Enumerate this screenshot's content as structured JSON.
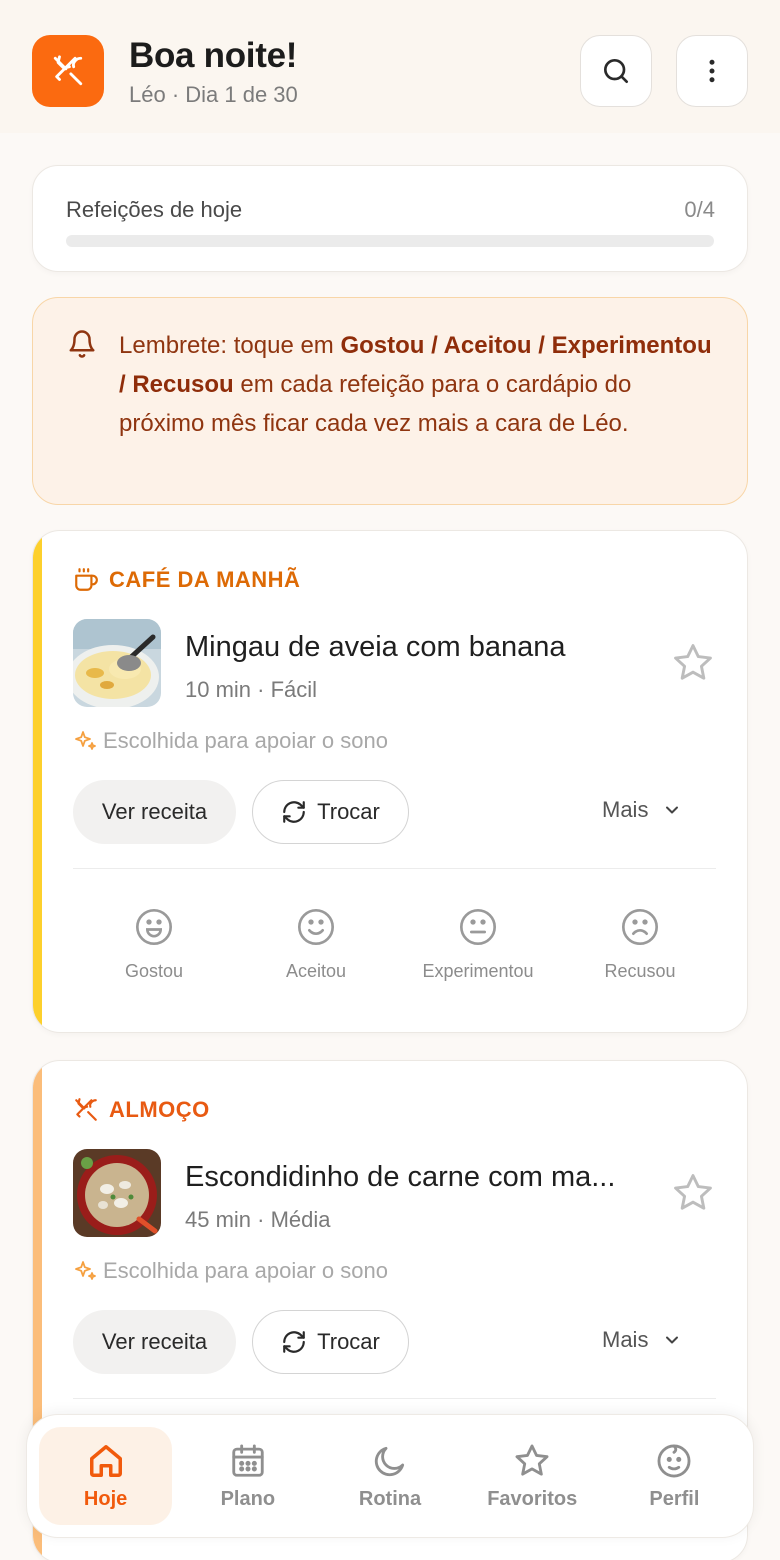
{
  "header": {
    "greeting": "Boa noite!",
    "subtitle": "Léo · Dia 1 de 30"
  },
  "progress": {
    "label": "Refeições de hoje",
    "count": "0/4",
    "completed": 0,
    "total": 4
  },
  "reminder": {
    "prefix": "Lembrete: toque em ",
    "bold": "Gostou / Aceitou / Experimentou / Recusou",
    "suffix": " em cada refeição para o cardápio do próximo mês ficar cada vez mais a cara de Léo."
  },
  "meals": [
    {
      "type": "CAFÉ DA MANHÃ",
      "title": "Mingau de aveia com banana",
      "meta": "10 min · Fácil",
      "reason": "Escolhida para apoiar o sono",
      "view_label": "Ver receita",
      "swap_label": "Trocar",
      "more_label": "Mais"
    },
    {
      "type": "ALMOÇO",
      "title": "Escondidinho de carne com ma...",
      "meta": "45 min · Média",
      "reason": "Escolhida para apoiar o sono",
      "view_label": "Ver receita",
      "swap_label": "Trocar",
      "more_label": "Mais"
    }
  ],
  "reactions": [
    "Gostou",
    "Aceitou",
    "Experimentou",
    "Recusou"
  ],
  "nav": [
    {
      "label": "Hoje",
      "icon": "home-icon",
      "active": true
    },
    {
      "label": "Plano",
      "icon": "calendar-icon",
      "active": false
    },
    {
      "label": "Rotina",
      "icon": "moon-icon",
      "active": false
    },
    {
      "label": "Favoritos",
      "icon": "star-icon",
      "active": false
    },
    {
      "label": "Perfil",
      "icon": "baby-face-icon",
      "active": false
    }
  ],
  "colors": {
    "accent": "#fb6a10",
    "breakfast_bar": "#fdd02c",
    "lunch_bar": "#fbbd7a"
  }
}
